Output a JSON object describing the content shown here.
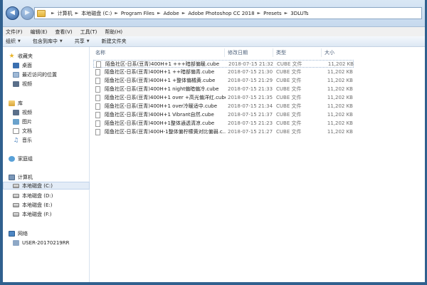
{
  "address": {
    "crumbs": [
      "计算机",
      "本地磁盘 (C:)",
      "Program Files",
      "Adobe",
      "Adobe Photoshop CC 2018",
      "Presets",
      "3DLUTs"
    ]
  },
  "menu": [
    "文件(F)",
    "编辑(E)",
    "查看(V)",
    "工具(T)",
    "帮助(H)"
  ],
  "toolbar": {
    "organize": "组织",
    "include": "包含到库中",
    "share": "共享",
    "newfolder": "新建文件夹"
  },
  "nav": {
    "favorites": "收藏夹",
    "desktop": "桌面",
    "recent": "最近访问的位置",
    "video_fav": "视频",
    "library": "库",
    "video": "视频",
    "pictures": "图片",
    "documents": "文档",
    "music": "音乐",
    "homegroup": "家庭组",
    "computer": "计算机",
    "drive_c": "本地磁盘 (C:)",
    "drive_d": "本地磁盘 (D:)",
    "drive_e": "本地磁盘 (E:)",
    "drive_f": "本地磁盘 (F:)",
    "network": "网络",
    "user": "USER-20170219RR"
  },
  "columns": {
    "name": "名称",
    "date": "修改日期",
    "type": "类型",
    "size": "大小"
  },
  "files": [
    {
      "name": "陌鱼社区-日系(豆青)400H+1 +++暗部偏暖.cube",
      "date": "2018-07-15 21:32",
      "type": "CUBE 文件",
      "size": "11,202 KB"
    },
    {
      "name": "陌鱼社区-日系(豆青)400H+1 ++暗部偏青.cube",
      "date": "2018-07-15 21:30",
      "type": "CUBE 文件",
      "size": "11,202 KB"
    },
    {
      "name": "陌鱼社区-日系(豆青)400H+1 +整体偏橘黄.cube",
      "date": "2018-07-15 21:29",
      "type": "CUBE 文件",
      "size": "11,202 KB"
    },
    {
      "name": "陌鱼社区-日系(豆青)400H+1 night偏暗偏冷.cube",
      "date": "2018-07-15 21:33",
      "type": "CUBE 文件",
      "size": "11,202 KB"
    },
    {
      "name": "陌鱼社区-日系(豆青)400H+1 over +高光偏洋红.cube",
      "date": "2018-07-15 21:35",
      "type": "CUBE 文件",
      "size": "11,202 KB"
    },
    {
      "name": "陌鱼社区-日系(豆青)400H+1 over冷暖适中.cube",
      "date": "2018-07-15 21:34",
      "type": "CUBE 文件",
      "size": "11,202 KB"
    },
    {
      "name": "陌鱼社区-日系(豆青)400H+1 Vibrant自然.cube",
      "date": "2018-07-15 21:37",
      "type": "CUBE 文件",
      "size": "11,202 KB"
    },
    {
      "name": "陌鱼社区-日系(豆青)400H+1整体通透清凉.cube",
      "date": "2018-07-15 21:23",
      "type": "CUBE 文件",
      "size": "11,202 KB"
    },
    {
      "name": "陌鱼社区-日系(豆青)400H-1整体偏柠檬黄对比偏弱.c...",
      "date": "2018-07-15 21:27",
      "type": "CUBE 文件",
      "size": "11,202 KB"
    }
  ]
}
